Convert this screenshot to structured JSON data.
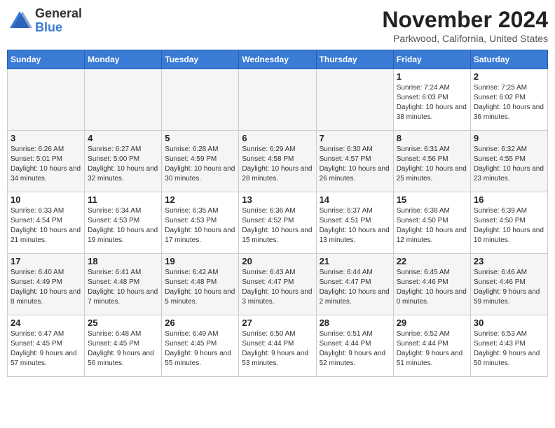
{
  "logo": {
    "general": "General",
    "blue": "Blue"
  },
  "title": "November 2024",
  "location": "Parkwood, California, United States",
  "days_of_week": [
    "Sunday",
    "Monday",
    "Tuesday",
    "Wednesday",
    "Thursday",
    "Friday",
    "Saturday"
  ],
  "weeks": [
    [
      {
        "day": "",
        "info": ""
      },
      {
        "day": "",
        "info": ""
      },
      {
        "day": "",
        "info": ""
      },
      {
        "day": "",
        "info": ""
      },
      {
        "day": "",
        "info": ""
      },
      {
        "day": "1",
        "info": "Sunrise: 7:24 AM\nSunset: 6:03 PM\nDaylight: 10 hours and 38 minutes."
      },
      {
        "day": "2",
        "info": "Sunrise: 7:25 AM\nSunset: 6:02 PM\nDaylight: 10 hours and 36 minutes."
      }
    ],
    [
      {
        "day": "3",
        "info": "Sunrise: 6:26 AM\nSunset: 5:01 PM\nDaylight: 10 hours and 34 minutes."
      },
      {
        "day": "4",
        "info": "Sunrise: 6:27 AM\nSunset: 5:00 PM\nDaylight: 10 hours and 32 minutes."
      },
      {
        "day": "5",
        "info": "Sunrise: 6:28 AM\nSunset: 4:59 PM\nDaylight: 10 hours and 30 minutes."
      },
      {
        "day": "6",
        "info": "Sunrise: 6:29 AM\nSunset: 4:58 PM\nDaylight: 10 hours and 28 minutes."
      },
      {
        "day": "7",
        "info": "Sunrise: 6:30 AM\nSunset: 4:57 PM\nDaylight: 10 hours and 26 minutes."
      },
      {
        "day": "8",
        "info": "Sunrise: 6:31 AM\nSunset: 4:56 PM\nDaylight: 10 hours and 25 minutes."
      },
      {
        "day": "9",
        "info": "Sunrise: 6:32 AM\nSunset: 4:55 PM\nDaylight: 10 hours and 23 minutes."
      }
    ],
    [
      {
        "day": "10",
        "info": "Sunrise: 6:33 AM\nSunset: 4:54 PM\nDaylight: 10 hours and 21 minutes."
      },
      {
        "day": "11",
        "info": "Sunrise: 6:34 AM\nSunset: 4:53 PM\nDaylight: 10 hours and 19 minutes."
      },
      {
        "day": "12",
        "info": "Sunrise: 6:35 AM\nSunset: 4:53 PM\nDaylight: 10 hours and 17 minutes."
      },
      {
        "day": "13",
        "info": "Sunrise: 6:36 AM\nSunset: 4:52 PM\nDaylight: 10 hours and 15 minutes."
      },
      {
        "day": "14",
        "info": "Sunrise: 6:37 AM\nSunset: 4:51 PM\nDaylight: 10 hours and 13 minutes."
      },
      {
        "day": "15",
        "info": "Sunrise: 6:38 AM\nSunset: 4:50 PM\nDaylight: 10 hours and 12 minutes."
      },
      {
        "day": "16",
        "info": "Sunrise: 6:39 AM\nSunset: 4:50 PM\nDaylight: 10 hours and 10 minutes."
      }
    ],
    [
      {
        "day": "17",
        "info": "Sunrise: 6:40 AM\nSunset: 4:49 PM\nDaylight: 10 hours and 8 minutes."
      },
      {
        "day": "18",
        "info": "Sunrise: 6:41 AM\nSunset: 4:48 PM\nDaylight: 10 hours and 7 minutes."
      },
      {
        "day": "19",
        "info": "Sunrise: 6:42 AM\nSunset: 4:48 PM\nDaylight: 10 hours and 5 minutes."
      },
      {
        "day": "20",
        "info": "Sunrise: 6:43 AM\nSunset: 4:47 PM\nDaylight: 10 hours and 3 minutes."
      },
      {
        "day": "21",
        "info": "Sunrise: 6:44 AM\nSunset: 4:47 PM\nDaylight: 10 hours and 2 minutes."
      },
      {
        "day": "22",
        "info": "Sunrise: 6:45 AM\nSunset: 4:46 PM\nDaylight: 10 hours and 0 minutes."
      },
      {
        "day": "23",
        "info": "Sunrise: 6:46 AM\nSunset: 4:46 PM\nDaylight: 9 hours and 59 minutes."
      }
    ],
    [
      {
        "day": "24",
        "info": "Sunrise: 6:47 AM\nSunset: 4:45 PM\nDaylight: 9 hours and 57 minutes."
      },
      {
        "day": "25",
        "info": "Sunrise: 6:48 AM\nSunset: 4:45 PM\nDaylight: 9 hours and 56 minutes."
      },
      {
        "day": "26",
        "info": "Sunrise: 6:49 AM\nSunset: 4:45 PM\nDaylight: 9 hours and 55 minutes."
      },
      {
        "day": "27",
        "info": "Sunrise: 6:50 AM\nSunset: 4:44 PM\nDaylight: 9 hours and 53 minutes."
      },
      {
        "day": "28",
        "info": "Sunrise: 6:51 AM\nSunset: 4:44 PM\nDaylight: 9 hours and 52 minutes."
      },
      {
        "day": "29",
        "info": "Sunrise: 6:52 AM\nSunset: 4:44 PM\nDaylight: 9 hours and 51 minutes."
      },
      {
        "day": "30",
        "info": "Sunrise: 6:53 AM\nSunset: 4:43 PM\nDaylight: 9 hours and 50 minutes."
      }
    ]
  ]
}
